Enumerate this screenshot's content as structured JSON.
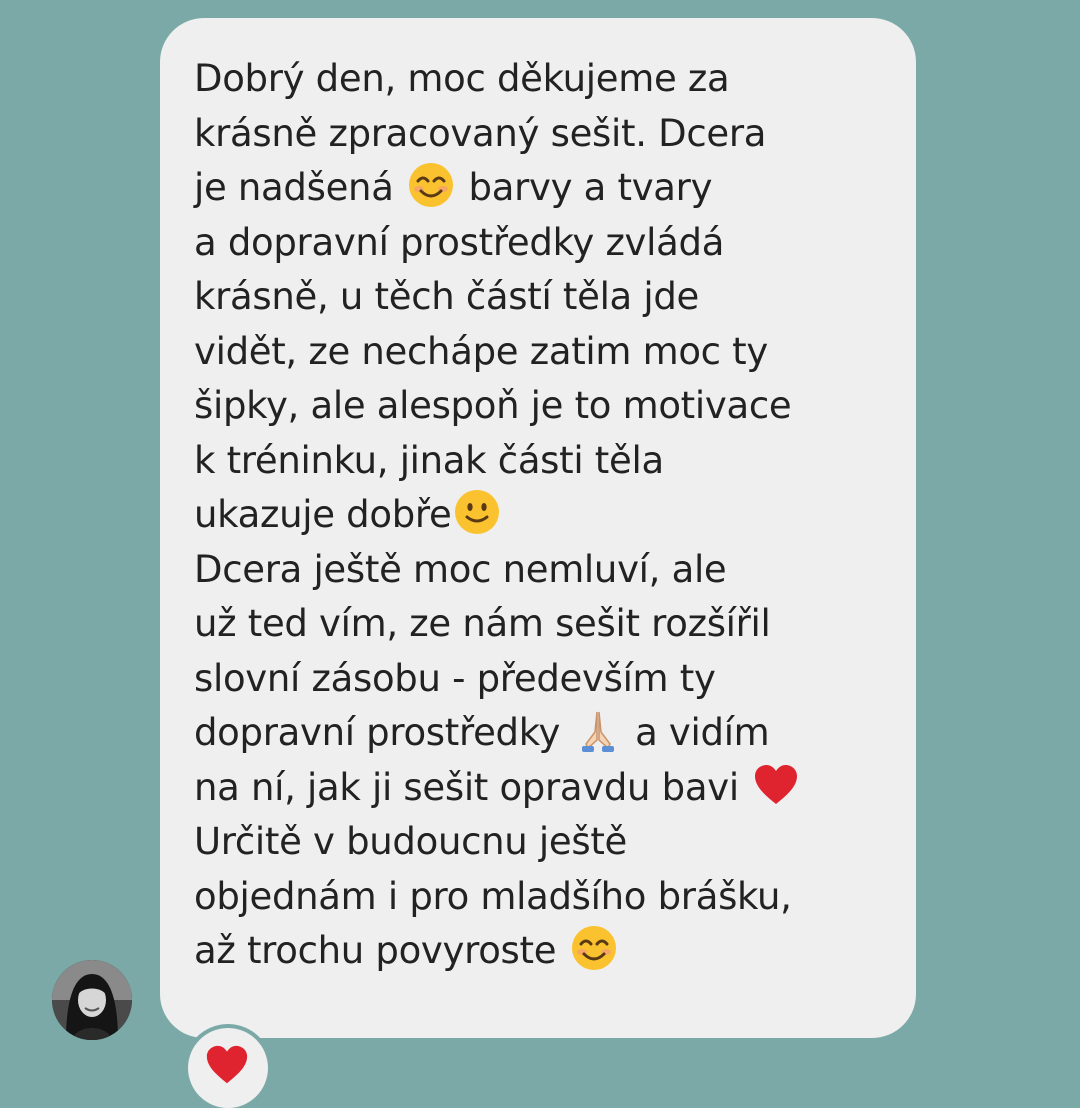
{
  "message": {
    "lines": [
      {
        "text": "Dobrý den, moc děkujeme za"
      },
      {
        "text": "krásně zpracovaný sešit. Dcera"
      },
      {
        "text": "je nadšená",
        "emoji": "smiling-face-icon",
        "after": "barvy a tvary"
      },
      {
        "text": "a dopravní prostředky zvládá"
      },
      {
        "text": "krásně, u těch částí těla jde"
      },
      {
        "text": "vidět, ze nechápe zatim moc ty"
      },
      {
        "text": "šipky, ale alespoň je to motivace"
      },
      {
        "text": "k tréninku, jinak části těla"
      },
      {
        "text": "ukazuje dobře",
        "emoji": "slight-smile-icon",
        "after": ""
      },
      {
        "text": "Dcera ještě moc nemluví, ale"
      },
      {
        "text": "už ted vím, ze nám sešit rozšířil"
      },
      {
        "text": "slovní zásobu - především ty"
      },
      {
        "text": "dopravní prostředky",
        "emoji": "folded-hands-icon",
        "after": "a vidím"
      },
      {
        "text": "na ní, jak ji sešit opravdu bavi",
        "emoji": "red-heart-icon",
        "after": ""
      },
      {
        "text": "Určitě v budoucnu ještě"
      },
      {
        "text": "objednám i pro mladšího brášku,"
      },
      {
        "text": "až trochu povyroste",
        "emoji": "smiling-face-icon",
        "after": ""
      }
    ]
  },
  "reaction": {
    "icon": "red-heart-icon"
  },
  "avatar": {
    "icon": "user-avatar"
  },
  "colors": {
    "background": "#7ba9a8",
    "bubble": "#efefef",
    "text": "#222222",
    "heart": "#e0242f"
  }
}
